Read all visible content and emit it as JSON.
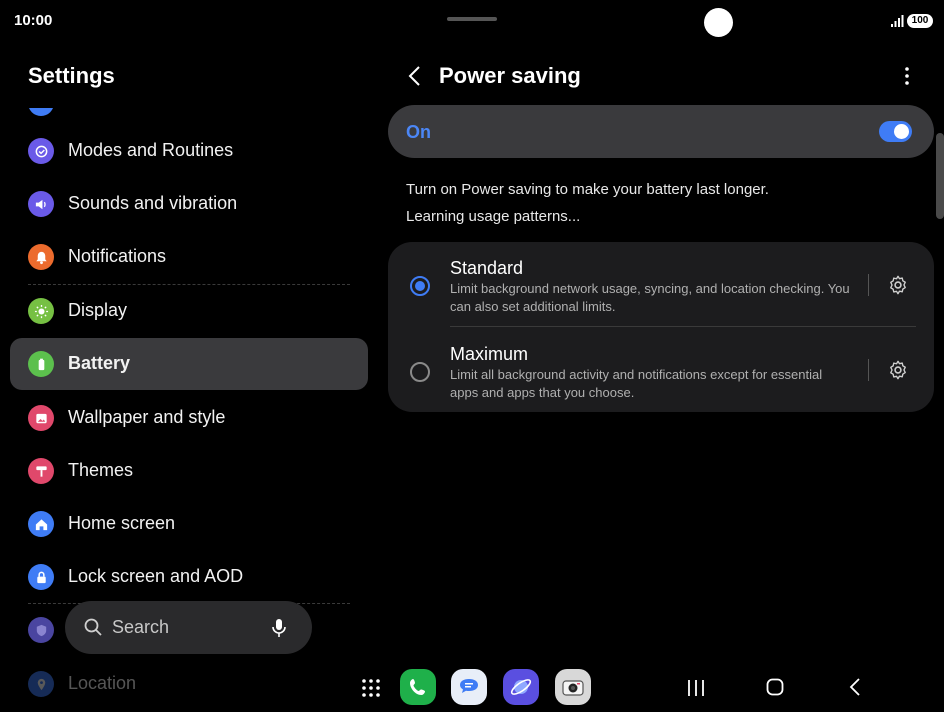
{
  "status": {
    "time": "10:00",
    "battery": "100"
  },
  "left": {
    "title": "Settings",
    "items": [
      {
        "label": "Modes and Routines",
        "icon": "modes-routines-icon",
        "color": "#6a5ae8"
      },
      {
        "label": "Sounds and vibration",
        "icon": "speaker-icon",
        "color": "#6a5ae8"
      },
      {
        "label": "Notifications",
        "icon": "bell-icon",
        "color": "#ec6b2d"
      },
      {
        "label": "Display",
        "icon": "sun-icon",
        "color": "#76c043"
      },
      {
        "label": "Battery",
        "icon": "battery-icon",
        "color": "#5cc04d"
      },
      {
        "label": "Wallpaper and style",
        "icon": "image-icon",
        "color": "#e0486b"
      },
      {
        "label": "Themes",
        "icon": "paint-roller-icon",
        "color": "#e0486b"
      },
      {
        "label": "Home screen",
        "icon": "house-icon",
        "color": "#3f7cf5"
      },
      {
        "label": "Lock screen and AOD",
        "icon": "lock-icon",
        "color": "#3f7cf5"
      },
      {
        "label": "Location",
        "icon": "location-pin-icon",
        "color": "#3f7cf5"
      }
    ],
    "search": {
      "label": "Search"
    }
  },
  "right": {
    "title": "Power saving",
    "switch_label": "On",
    "switch_on": true,
    "description_line1": "Turn on Power saving to make your battery last longer.",
    "description_line2": "Learning usage patterns...",
    "options": [
      {
        "title": "Standard",
        "description": "Limit background network usage, syncing, and location checking. You can also set additional limits.",
        "selected": true
      },
      {
        "title": "Maximum",
        "description": "Limit all background activity and notifications except for essential apps and apps that you choose.",
        "selected": false
      }
    ]
  },
  "dock": {
    "apps": [
      {
        "name": "phone-app-icon",
        "color": "#1fb04a"
      },
      {
        "name": "messages-app-icon",
        "color": "#e8eef8"
      },
      {
        "name": "internet-app-icon",
        "color": "#5a4fe0"
      },
      {
        "name": "camera-app-icon",
        "color": "#d8d8d8"
      }
    ]
  }
}
